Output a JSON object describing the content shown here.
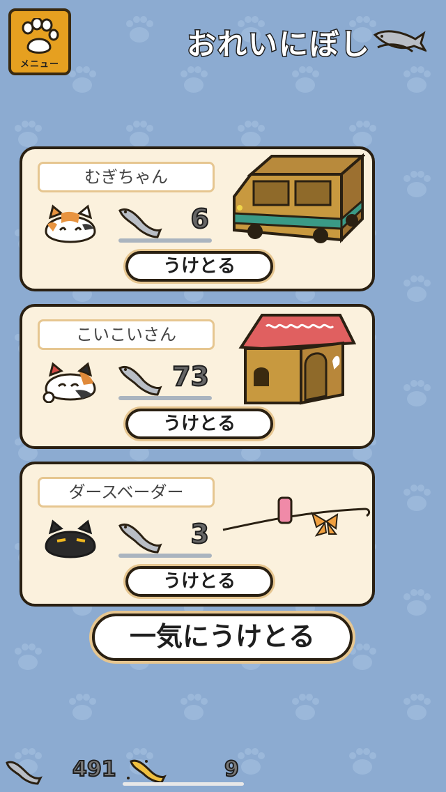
{
  "header": {
    "menu_label": "メニュー",
    "title": "おれいにぼし"
  },
  "gifts": [
    {
      "cat_name": "むぎちゃん",
      "fish_count": "6",
      "button_label": "うけとる"
    },
    {
      "cat_name": "こいこいさん",
      "fish_count": "73",
      "button_label": "うけとる"
    },
    {
      "cat_name": "ダースベーダー",
      "fish_count": "3",
      "button_label": "うけとる"
    }
  ],
  "receive_all_label": "一気にうけとる",
  "footer": {
    "silver_fish": "491",
    "gold_fish": "9"
  },
  "colors": {
    "background": "#8cabd1",
    "card": "#fbf1dd",
    "menu": "#e6a020",
    "outline": "#2a2012"
  }
}
